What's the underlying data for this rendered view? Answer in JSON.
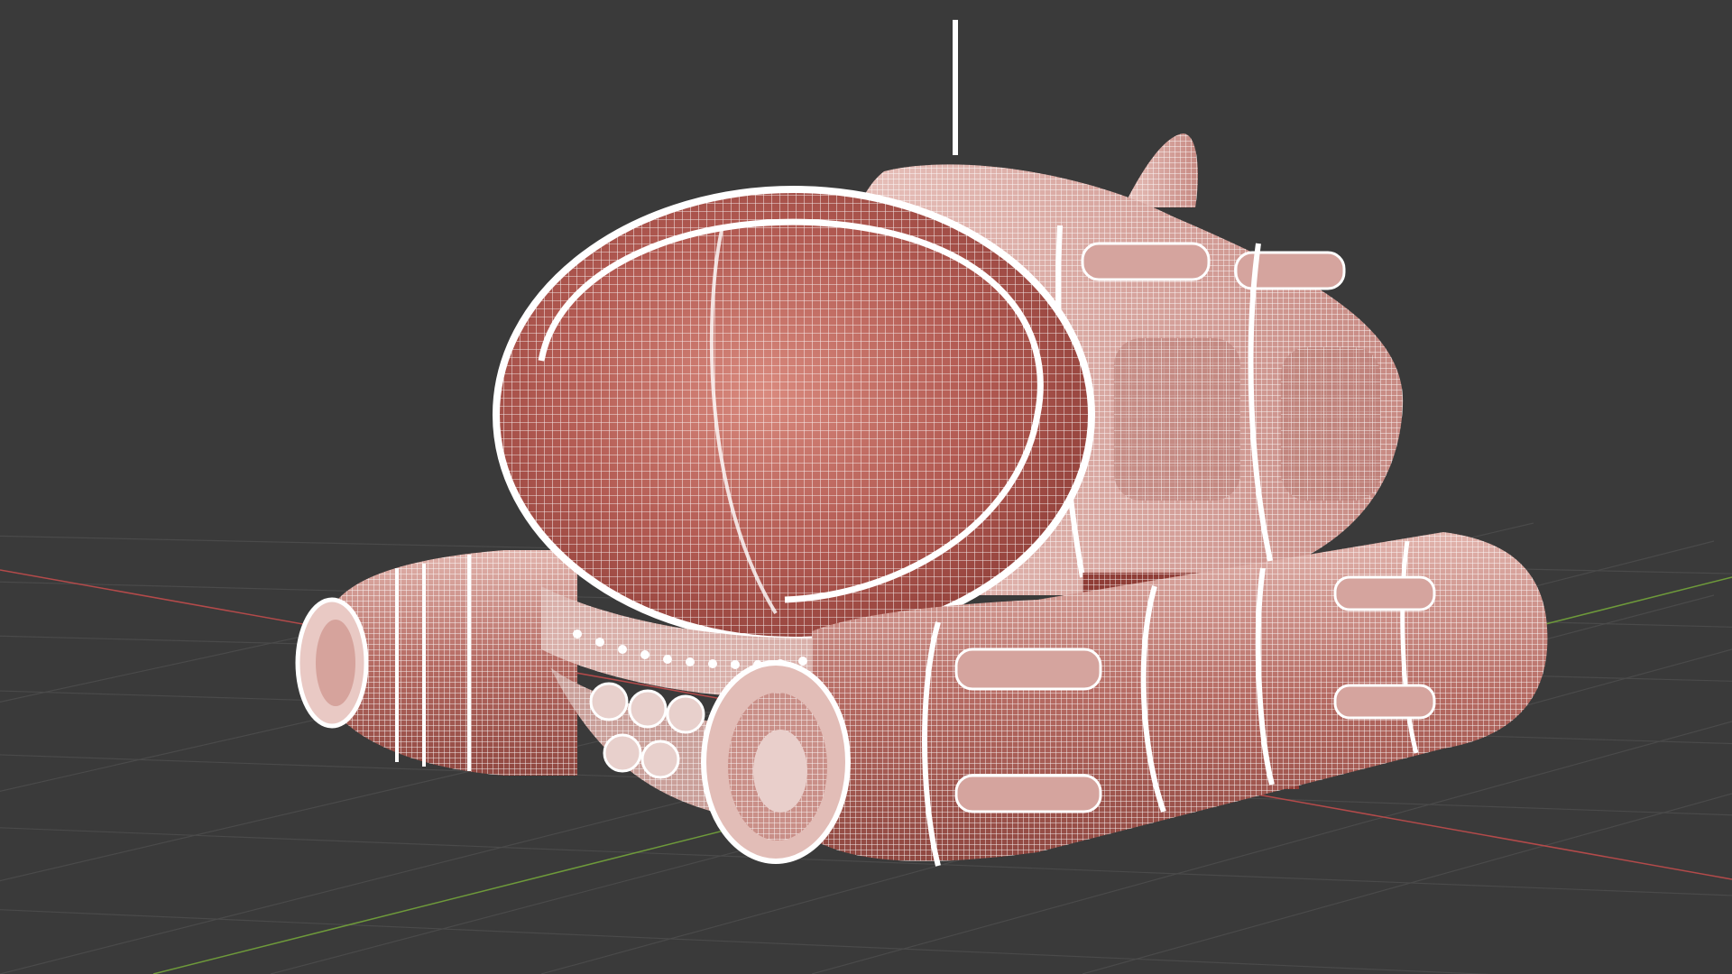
{
  "viewport": {
    "kind": "3d-viewport",
    "shading": "wireframe-overlay",
    "background_color": "#3a3a3a",
    "grid_line_color": "#4a4a4a",
    "x_axis_color": "#b34a4a",
    "y_axis_color": "#6e9a3a"
  },
  "model": {
    "surface_color": "#b25a52",
    "wire_color": "#ffffff",
    "parts": [
      "cockpit-dome",
      "hull",
      "antenna",
      "dorsal-fin",
      "left-engine-pod",
      "right-engine-pod",
      "bolt-ring",
      "thruster-nozzles"
    ]
  }
}
